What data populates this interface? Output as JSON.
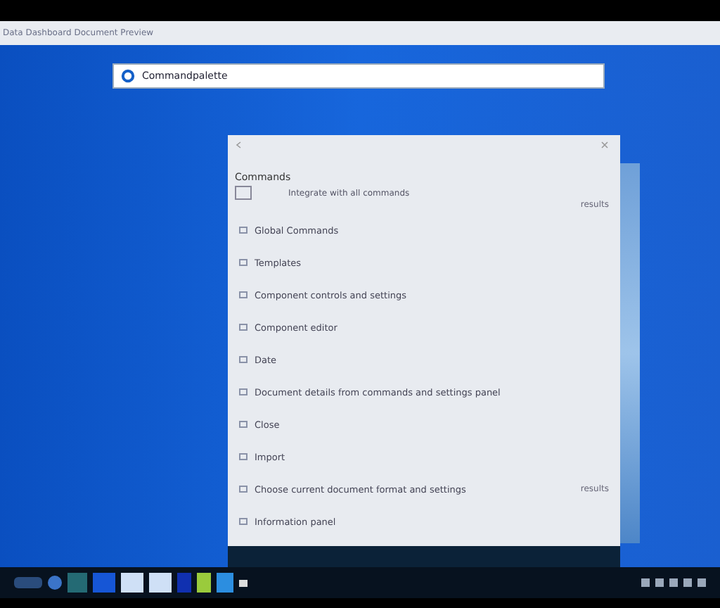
{
  "window": {
    "title": "Data Dashboard Document Preview"
  },
  "search": {
    "value": "Commandpalette"
  },
  "panel": {
    "heading": "Commands",
    "option": {
      "label": "Integrate with all commands",
      "checked": false
    },
    "option_note": "results",
    "items": [
      {
        "label": "Global Commands"
      },
      {
        "label": "Templates"
      },
      {
        "label": "Component controls and settings"
      },
      {
        "label": "Component editor"
      },
      {
        "label": "Date"
      },
      {
        "label": "Document details from commands and settings panel"
      },
      {
        "label": "Close"
      },
      {
        "label": "Import"
      },
      {
        "label": "Choose current document format and settings",
        "note": "results"
      },
      {
        "label": "Information panel"
      }
    ]
  }
}
